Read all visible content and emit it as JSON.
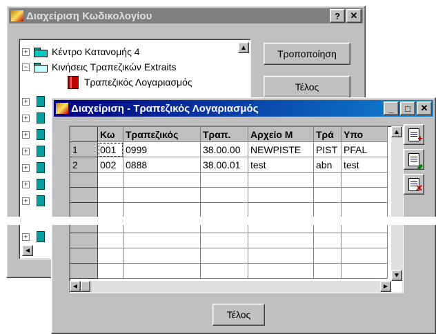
{
  "back_window": {
    "title": "Διαχείριση Κωδικολογίου",
    "help_label": "?",
    "close_label": "✕",
    "tree": [
      {
        "label": "Κέντρο Κατανομής 4",
        "expander": "+",
        "icon": "folder-icon"
      },
      {
        "label": "Κινήσεις Τραπεζικών Extraits",
        "expander": "−",
        "icon": "folder-open-icon"
      },
      {
        "label": "Τραπεζικός Λογαριασμός",
        "expander": "",
        "icon": "book-icon"
      }
    ],
    "modify_button": "Τροποποίηση",
    "close_button": "Τέλος"
  },
  "front_window": {
    "title": "Διαχείριση - Τραπεζικός Λογαριασμός",
    "minimize": "_",
    "maximize": "□",
    "close": "✕",
    "columns": [
      "Κω",
      "Τραπεζικός",
      "Τραπ.",
      "Αρχείο Μ",
      "Τρά",
      "Υπο"
    ],
    "rows": [
      [
        "1",
        "001",
        "0999",
        "38.00.00",
        "NEWPISTE",
        "PIST",
        "PFAL"
      ],
      [
        "2",
        "002",
        "0888",
        "38.00.01",
        "test",
        "abn",
        "test"
      ]
    ],
    "empty_rows": 7,
    "close_button": "Τέλος",
    "side_buttons": [
      "add-record-icon",
      "edit-record-icon",
      "delete-record-icon"
    ],
    "colors": {
      "title_bar": "#000080",
      "face": "#c0c0c0"
    }
  }
}
